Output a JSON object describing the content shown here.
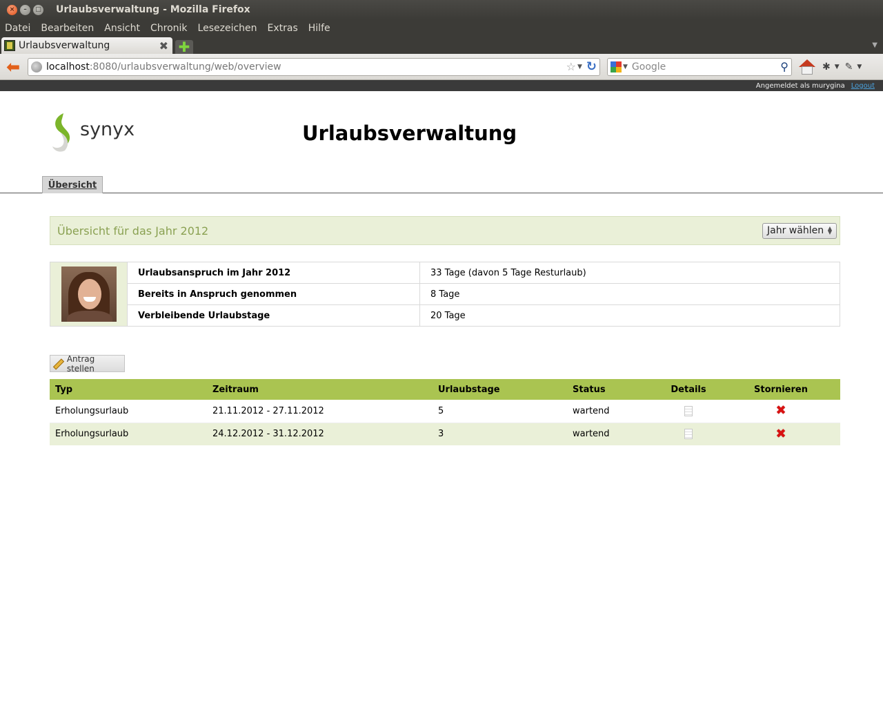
{
  "window": {
    "title": "Urlaubsverwaltung - Mozilla Firefox",
    "buttons": [
      "×",
      "–",
      "□"
    ]
  },
  "menubar": {
    "items": [
      "Datei",
      "Bearbeiten",
      "Ansicht",
      "Chronik",
      "Lesezeichen",
      "Extras",
      "Hilfe"
    ]
  },
  "tabbar": {
    "active_tab": "Urlaubsverwaltung",
    "close_glyph": "✖",
    "new_tab_glyph": "✚"
  },
  "navbar": {
    "url_host": "localhost",
    "url_path": ":8080/urlaubsverwaltung/web/overview",
    "search_placeholder": "Google"
  },
  "userbar": {
    "logged_in_text": "Angemeldet als murygina",
    "logout_label": "Logout"
  },
  "header": {
    "logo_text": "synyx",
    "app_title": "Urlaubsverwaltung"
  },
  "nav": {
    "tab_overview": "Übersicht"
  },
  "overview": {
    "year_heading": "Übersicht für das Jahr 2012",
    "year_select": "Jahr wählen"
  },
  "entitlement": {
    "rows": [
      {
        "label": "Urlaubsanspruch im Jahr 2012",
        "value": "33 Tage (davon 5 Tage Resturlaub)"
      },
      {
        "label": "Bereits in Anspruch genommen",
        "value": "8 Tage"
      },
      {
        "label": "Verbleibende Urlaubstage",
        "value": "20 Tage"
      }
    ]
  },
  "actions": {
    "new_request": "Antrag stellen"
  },
  "requests": {
    "headers": {
      "type": "Typ",
      "period": "Zeitraum",
      "days": "Urlaubstage",
      "status": "Status",
      "details": "Details",
      "cancel": "Stornieren"
    },
    "rows": [
      {
        "type": "Erholungsurlaub",
        "period": "21.11.2012 - 27.11.2012",
        "days": "5",
        "status": "wartend"
      },
      {
        "type": "Erholungsurlaub",
        "period": "24.12.2012 - 31.12.2012",
        "days": "3",
        "status": "wartend"
      }
    ]
  },
  "colors": {
    "accent_green": "#aac451",
    "light_green": "#eaf0d8",
    "cancel_red": "#d91111",
    "link_blue": "#4aa3df"
  },
  "icons": {
    "details": "document-icon",
    "cancel": "red-x-icon",
    "new_request": "pencil-icon"
  }
}
